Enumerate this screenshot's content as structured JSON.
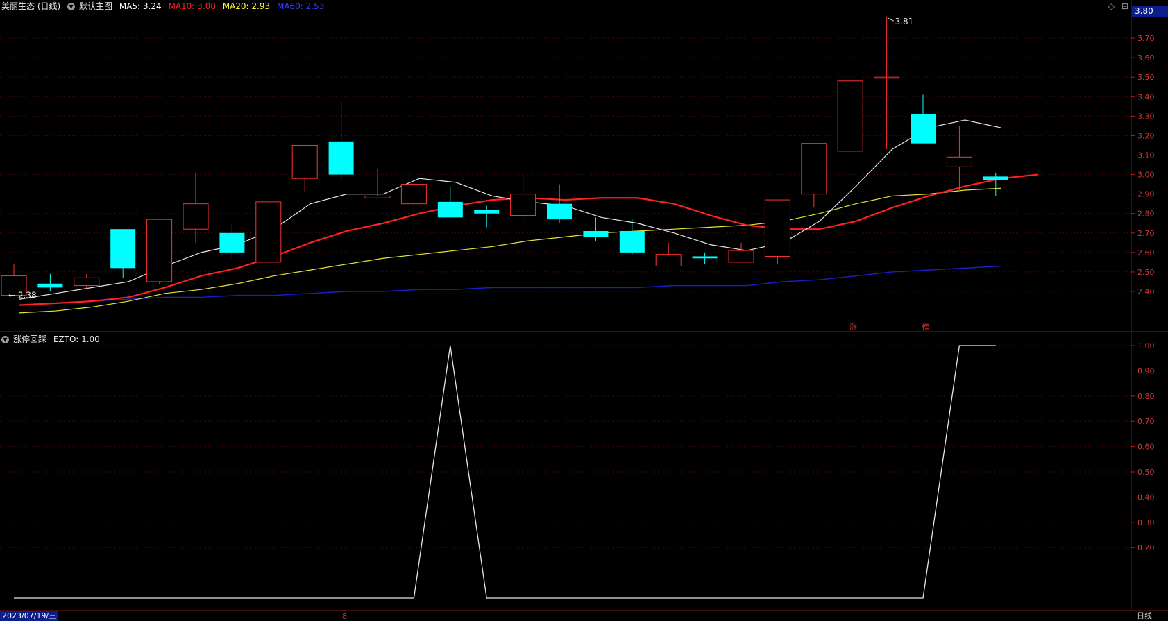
{
  "header": {
    "stock_name": "美丽生态 (日线)",
    "main_chart_label": "默认主图",
    "ma5": "MA5: 3.24",
    "ma10": "MA10: 3.00",
    "ma20": "MA20: 2.93",
    "ma60": "MA60: 2.53",
    "colors": {
      "ma5": "#ffffff",
      "ma10": "#ff2020",
      "ma20": "#ffff33",
      "ma60": "#2c2cff"
    }
  },
  "toolbar": {
    "icons": "◇ ⊟"
  },
  "price_axis": {
    "current_price": "3.80",
    "ticks": [
      "3.70",
      "3.60",
      "3.50",
      "3.40",
      "3.30",
      "3.20",
      "3.10",
      "3.00",
      "2.90",
      "2.80",
      "2.70",
      "2.60",
      "2.50",
      "2.40"
    ]
  },
  "indicator": {
    "name": "涨停回踩",
    "value_label": "EZTO: 1.00",
    "ticks": [
      "1.00",
      "0.90",
      "0.80",
      "0.70",
      "0.60",
      "0.50",
      "0.40",
      "0.30",
      "0.20"
    ]
  },
  "annotations": {
    "high_label": "3.81",
    "low_label": "2.38",
    "flag_limit_up": "涨",
    "flag_board": "榜"
  },
  "footer": {
    "date": "2023/07/19/三",
    "period": "日线",
    "marker": "8"
  },
  "chart_data": {
    "type": "candlestick",
    "price_range": [
      2.24,
      3.83
    ],
    "candles": [
      {
        "o": 2.38,
        "c": 2.48,
        "h": 2.54,
        "l": 2.38
      },
      {
        "o": 2.44,
        "c": 2.42,
        "h": 2.49,
        "l": 2.4
      },
      {
        "o": 2.43,
        "c": 2.47,
        "h": 2.49,
        "l": 2.41
      },
      {
        "o": 2.72,
        "c": 2.52,
        "h": 2.72,
        "l": 2.47
      },
      {
        "o": 2.45,
        "c": 2.77,
        "h": 2.77,
        "l": 2.44
      },
      {
        "o": 2.72,
        "c": 2.85,
        "h": 3.01,
        "l": 2.65
      },
      {
        "o": 2.7,
        "c": 2.6,
        "h": 2.75,
        "l": 2.57
      },
      {
        "o": 2.55,
        "c": 2.86,
        "h": 2.86,
        "l": 2.55
      },
      {
        "o": 2.98,
        "c": 3.15,
        "h": 3.15,
        "l": 2.91
      },
      {
        "o": 3.17,
        "c": 3.0,
        "h": 3.38,
        "l": 2.97
      },
      {
        "o": 2.88,
        "c": 2.89,
        "h": 3.03,
        "l": 2.88
      },
      {
        "o": 2.85,
        "c": 2.95,
        "h": 2.95,
        "l": 2.72
      },
      {
        "o": 2.86,
        "c": 2.78,
        "h": 2.94,
        "l": 2.78
      },
      {
        "o": 2.82,
        "c": 2.8,
        "h": 2.84,
        "l": 2.73
      },
      {
        "o": 2.79,
        "c": 2.9,
        "h": 3.0,
        "l": 2.76
      },
      {
        "o": 2.85,
        "c": 2.77,
        "h": 2.95,
        "l": 2.75
      },
      {
        "o": 2.71,
        "c": 2.68,
        "h": 2.78,
        "l": 2.66
      },
      {
        "o": 2.71,
        "c": 2.6,
        "h": 2.77,
        "l": 2.59
      },
      {
        "o": 2.53,
        "c": 2.59,
        "h": 2.65,
        "l": 2.53
      },
      {
        "o": 2.58,
        "c": 2.57,
        "h": 2.6,
        "l": 2.54
      },
      {
        "o": 2.55,
        "c": 2.61,
        "h": 2.65,
        "l": 2.55
      },
      {
        "o": 2.58,
        "c": 2.87,
        "h": 2.87,
        "l": 2.54
      },
      {
        "o": 2.9,
        "c": 3.16,
        "h": 3.16,
        "l": 2.83
      },
      {
        "o": 3.12,
        "c": 3.48,
        "h": 3.48,
        "l": 3.12
      },
      {
        "o": 3.5,
        "c": 3.5,
        "h": 3.81,
        "l": 3.13
      },
      {
        "o": 3.31,
        "c": 3.16,
        "h": 3.41,
        "l": 3.16
      },
      {
        "o": 3.04,
        "c": 3.09,
        "h": 3.25,
        "l": 2.91
      },
      {
        "o": 2.99,
        "c": 2.97,
        "h": 3.01,
        "l": 2.89
      }
    ],
    "ma5": [
      2.36,
      2.39,
      2.42,
      2.45,
      2.53,
      2.6,
      2.64,
      2.72,
      2.85,
      2.9,
      2.9,
      2.98,
      2.96,
      2.89,
      2.86,
      2.84,
      2.78,
      2.75,
      2.7,
      2.64,
      2.61,
      2.65,
      2.76,
      2.94,
      3.13,
      3.24,
      3.28,
      3.24
    ],
    "ma10": [
      2.33,
      2.34,
      2.35,
      2.37,
      2.42,
      2.48,
      2.52,
      2.58,
      2.65,
      2.71,
      2.75,
      2.8,
      2.84,
      2.87,
      2.88,
      2.87,
      2.88,
      2.88,
      2.85,
      2.79,
      2.74,
      2.72,
      2.72,
      2.76,
      2.83,
      2.89,
      2.94,
      2.98,
      3.0
    ],
    "ma20": [
      2.29,
      2.3,
      2.32,
      2.35,
      2.39,
      2.41,
      2.44,
      2.48,
      2.51,
      2.54,
      2.57,
      2.59,
      2.61,
      2.63,
      2.66,
      2.68,
      2.7,
      2.71,
      2.72,
      2.73,
      2.74,
      2.76,
      2.8,
      2.85,
      2.89,
      2.9,
      2.92,
      2.93
    ],
    "ma60": [
      2.35,
      2.36,
      2.37,
      2.37,
      2.38,
      2.38,
      2.39,
      2.4,
      2.4,
      2.41,
      2.41,
      2.42,
      2.42,
      2.42,
      2.42,
      2.42,
      2.43,
      2.43,
      2.43,
      2.45,
      2.46,
      2.48,
      2.5,
      2.51,
      2.52,
      2.53
    ],
    "ezto": [
      0,
      0,
      0,
      0,
      0,
      0,
      0,
      0,
      0,
      0,
      0,
      0,
      1,
      0,
      0,
      0,
      0,
      0,
      0,
      0,
      0,
      0,
      0,
      0,
      0,
      0,
      1,
      1
    ]
  }
}
